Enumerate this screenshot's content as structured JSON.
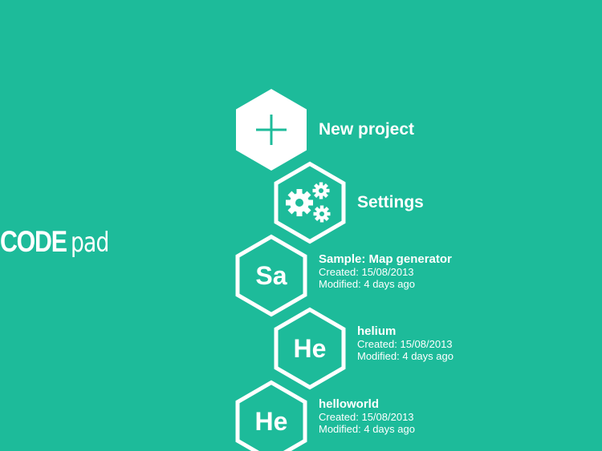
{
  "app": {
    "logo_bold": "CODE",
    "logo_light": "pad"
  },
  "colors": {
    "background": "#1dbb9a",
    "foreground": "#ffffff"
  },
  "menu": {
    "new_project": {
      "label": "New project",
      "icon": "plus-icon"
    },
    "settings": {
      "label": "Settings",
      "icon": "gears-icon"
    }
  },
  "projects": [
    {
      "symbol": "Sa",
      "name": "Sample: Map generator",
      "created": "Created: 15/08/2013",
      "modified": "Modified: 4 days ago"
    },
    {
      "symbol": "He",
      "name": "helium",
      "created": "Created: 15/08/2013",
      "modified": "Modified: 4 days ago"
    },
    {
      "symbol": "He",
      "name": "helloworld",
      "created": "Created: 15/08/2013",
      "modified": "Modified: 4 days ago"
    }
  ]
}
